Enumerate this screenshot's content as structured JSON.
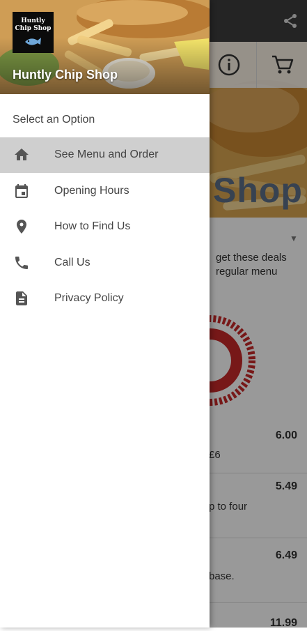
{
  "background": {
    "hero_title": "Shop",
    "deals_line1": "get these deals",
    "deals_line2": "regular menu",
    "items": [
      {
        "price": "6.00",
        "desc": "£6"
      },
      {
        "price": "5.49",
        "desc": "p to four"
      },
      {
        "price": "6.49",
        "desc": "base."
      },
      {
        "price": "11.99",
        "desc": ""
      }
    ]
  },
  "drawer": {
    "logo_line1": "Huntly",
    "logo_line2": "Chip Shop",
    "shop_name": "Huntly Chip Shop",
    "select_label": "Select an Option",
    "items": [
      {
        "label": "See Menu and Order",
        "icon": "home-icon"
      },
      {
        "label": "Opening Hours",
        "icon": "calendar-icon"
      },
      {
        "label": "How to Find Us",
        "icon": "location-pin-icon"
      },
      {
        "label": "Call Us",
        "icon": "phone-icon"
      },
      {
        "label": "Privacy Policy",
        "icon": "document-icon"
      }
    ]
  },
  "colors": {
    "drawer_active_bg": "#cfcfcf",
    "icon_color": "#555555"
  }
}
